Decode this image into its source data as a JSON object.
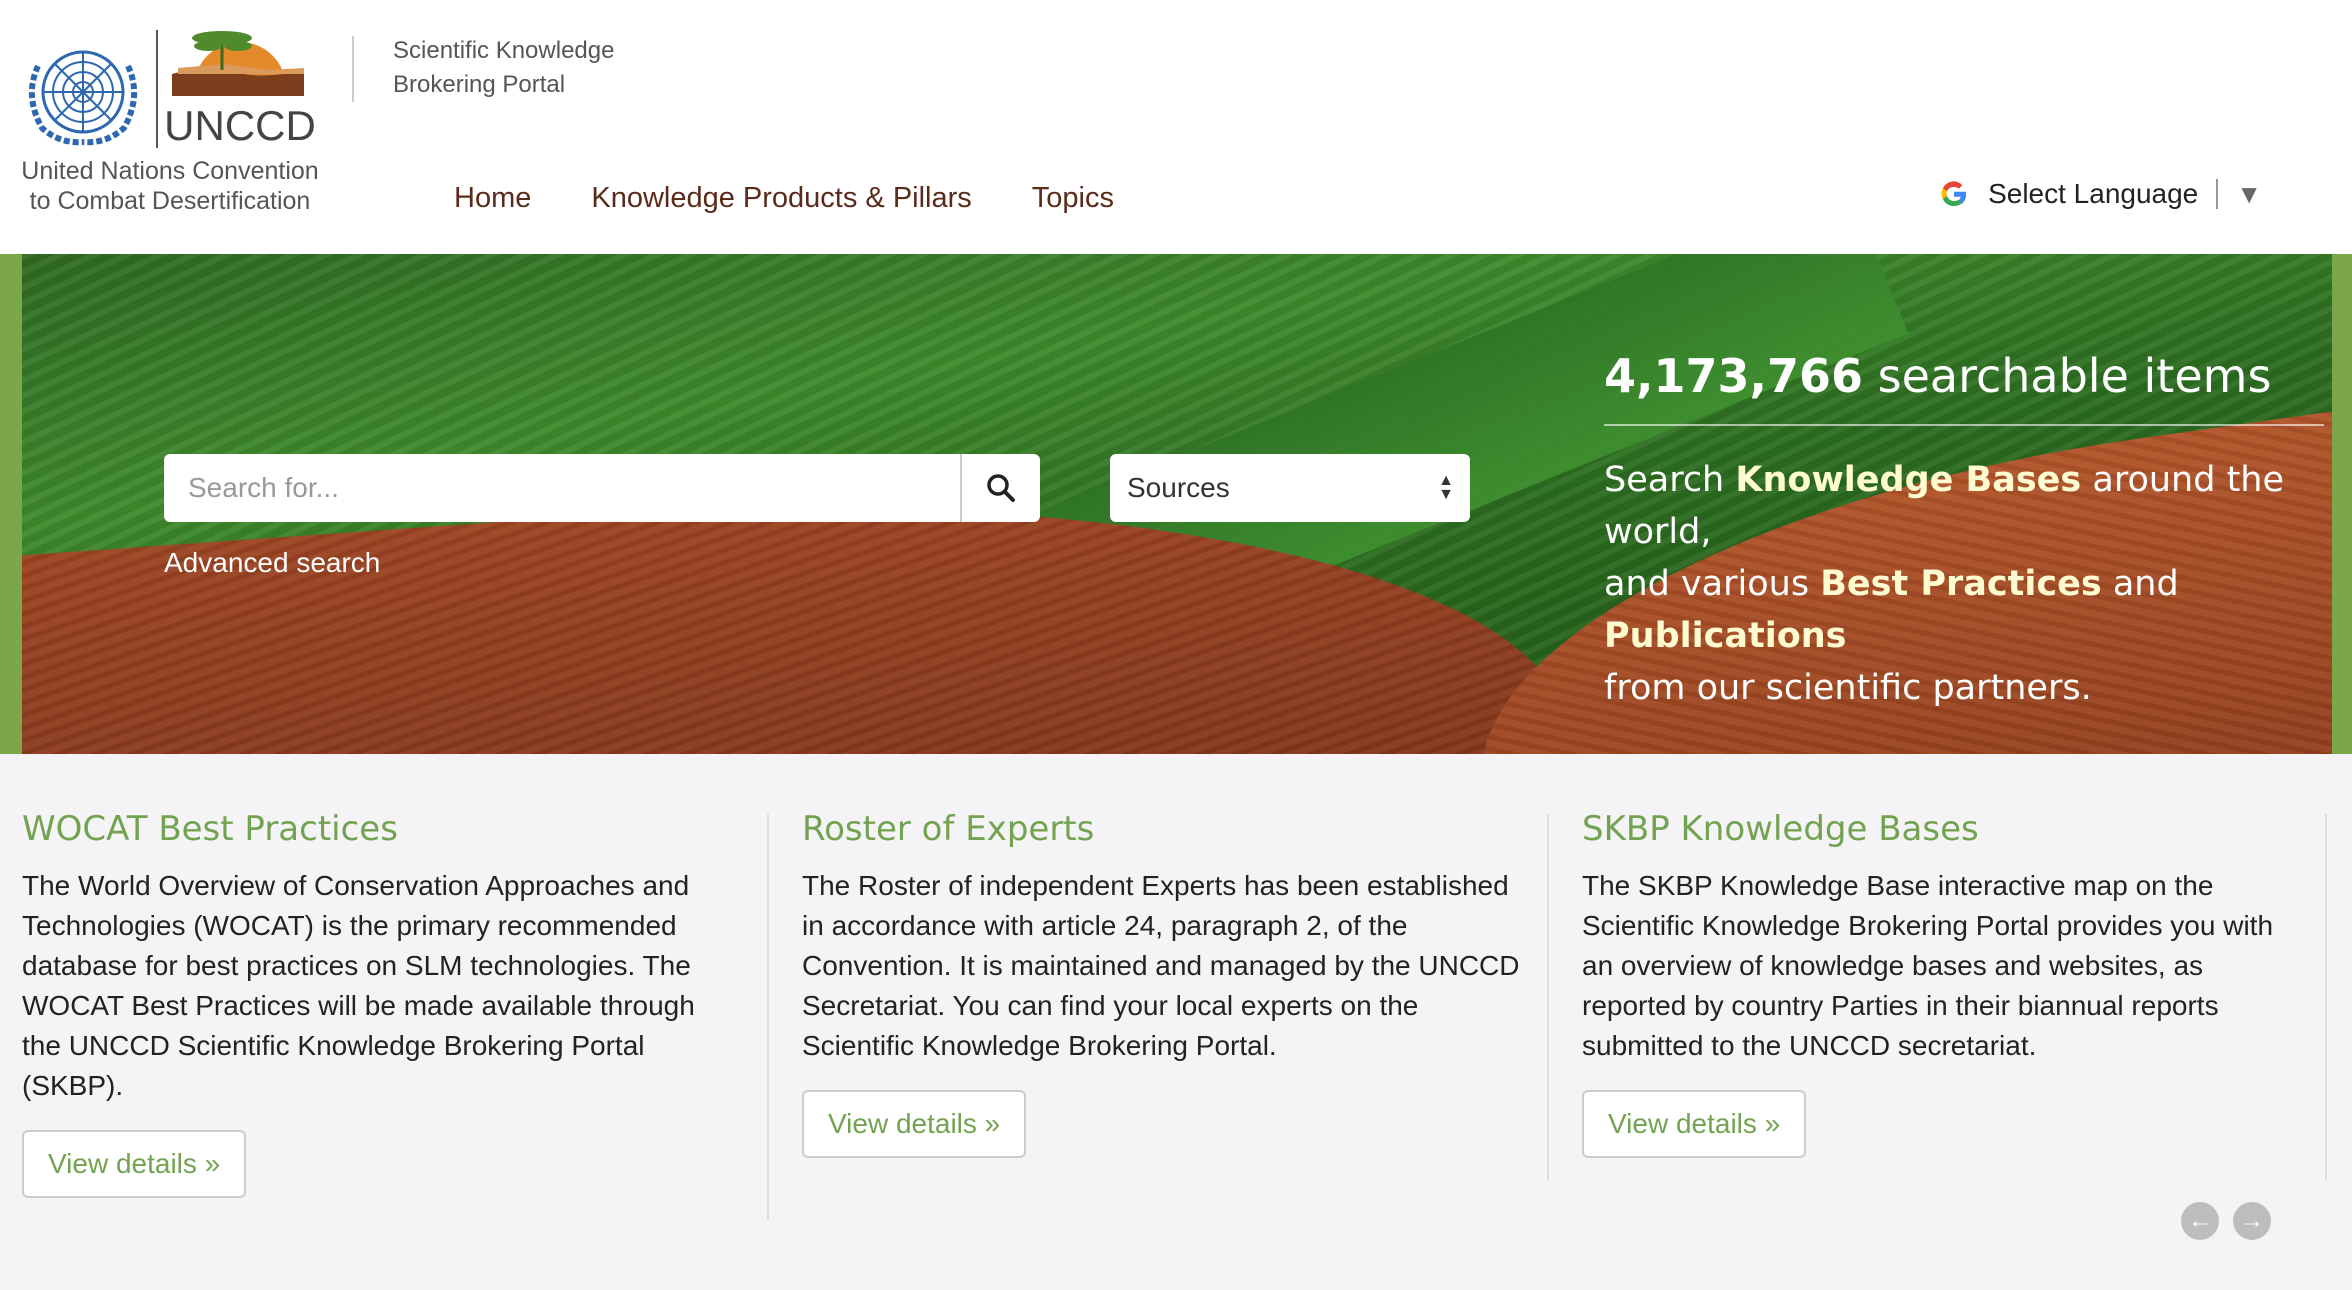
{
  "brand": {
    "logo_text": "UNCCD",
    "caption_line1": "United Nations Convention",
    "caption_line2": "to Combat Desertification",
    "portal_line1": "Scientific Knowledge",
    "portal_line2": "Brokering Portal"
  },
  "nav": {
    "items": [
      {
        "label": "Home"
      },
      {
        "label": "Knowledge Products & Pillars"
      },
      {
        "label": "Topics"
      }
    ]
  },
  "language": {
    "label": "Select Language",
    "icon": "google-g-icon"
  },
  "hero": {
    "search_placeholder": "Search for...",
    "sources_label": "Sources",
    "advanced_search": "Advanced search",
    "count": "4,173,766",
    "count_suffix": " searchable items",
    "desc_1": "Search ",
    "desc_kb": "Knowledge Bases",
    "desc_2": " around the world,",
    "desc_3": "and various ",
    "desc_bp": "Best Practices",
    "desc_4": " and ",
    "desc_pub": "Publications",
    "desc_5": "from our scientific partners."
  },
  "columns": [
    {
      "title": "WOCAT Best Practices",
      "text": "The World Overview of Conservation Approaches and Technologies (WOCAT) is the primary recommended database for best practices on SLM technologies. The WOCAT Best Practices will be made available through the UNCCD Scientific Knowledge Brokering Portal (SKBP).",
      "button": "View details »"
    },
    {
      "title": "Roster of Experts",
      "text": "The Roster of independent Experts has been established in accordance with article 24, paragraph 2, of the Convention. It is maintained and managed by the UNCCD Secretariat. You can find your local experts on the Scientific Knowledge Brokering Portal.",
      "button": "View details »"
    },
    {
      "title": "SKBP Knowledge Bases",
      "text": "The SKBP Knowledge Base interactive map on the Scientific Knowledge Brokering Portal provides you with an overview of knowledge bases and websites, as reported by country Parties in their biannual reports submitted to the UNCCD secretariat.",
      "button": "View details »"
    }
  ],
  "colors": {
    "accent_green": "#73a350",
    "nav_brown": "#5b2a1a",
    "hero_border": "#7ba64a"
  }
}
